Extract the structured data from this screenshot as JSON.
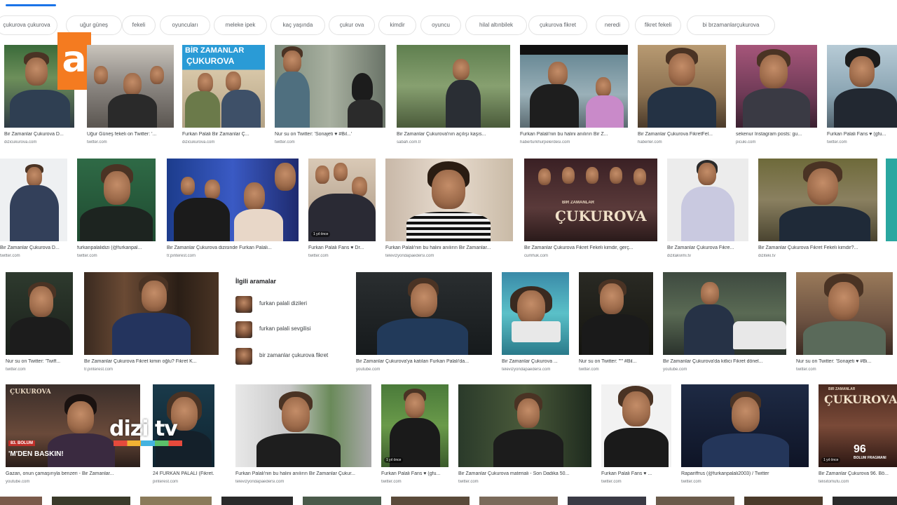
{
  "header": {
    "active_tab_indicator": true
  },
  "chips": [
    "çukurova çukurova",
    "uğur güneş",
    "fekeli",
    "oyuncuları",
    "meleke ipek",
    "kaç yaşında",
    "çukur ova",
    "kimdir",
    "oyuncu",
    "hilal altınbilek",
    "çukurova fikret",
    "neredi",
    "fikret fekeli",
    "bi brzamanlarçukurova"
  ],
  "results": {
    "row1": [
      {
        "caption": "Bir Zamanlar Çukurova D...",
        "source": "dizicukurova.com"
      },
      {
        "caption": "Uğur Güneş fekeli on Twitter: '...",
        "source": "twitter.com"
      },
      {
        "caption": "Furkan Palali Bir Zamanlar Ç...",
        "source": "dizicukurova.com"
      },
      {
        "caption": "Nur su on Twitter: 'Sonajeti ♥ #Bil...'",
        "source": "twitter.com"
      },
      {
        "caption": "Bir Zamanlar Çukurova'nın açılışı kaşıs...",
        "source": "sabah.com.tr"
      },
      {
        "caption": "Furkan Palali'nin bu halini anılırın Bir Z...",
        "source": "haberturkhurpelerdesi.com"
      },
      {
        "caption": "Bir Zamanlar Çukurova FikretFel...",
        "source": "haberler.com"
      },
      {
        "caption": "sekenur Instagram posts: gu...",
        "source": "picuki.com"
      },
      {
        "caption": "Furkan Palali Fans ♥ (gfu...",
        "source": "twitter.com"
      }
    ],
    "row2": [
      {
        "caption": "Bir Zamanlar Çukurova D...",
        "source": "twitter.com"
      },
      {
        "caption": "furkanpalalidizi (@furkanpal...",
        "source": "twitter.com"
      },
      {
        "caption": "Bir Zamanlar Çukurova dizisinde Furkan Palali...",
        "source": "tr.pinterest.com"
      },
      {
        "caption": "Furkan Palali Fans ♥ Dr...",
        "source": "twitter.com"
      },
      {
        "caption": "Furkan Palali'nin bu halini anılırın Bir Zamanlar...",
        "source": "televizyondapaedersi.com"
      },
      {
        "caption": "Bir Zamanlar Çukurova Fikret Fekeli kimdir, gerç...",
        "source": "cumhuk.com"
      },
      {
        "caption": "Bir Zamanlar Çukurova Fikre...",
        "source": "dizitakvimi.tv"
      },
      {
        "caption": "Bir Zamanlar Çukurova Fikret Fekeli kimdir?...",
        "source": "diziteki.tv"
      },
      {
        "caption": "",
        "source": ""
      }
    ],
    "row3": [
      {
        "caption": "Nur su on Twitter: 'Twiff...",
        "source": "twitter.com"
      },
      {
        "caption": "Bir Zamanlar Çukurova Fikret kimin oğlu? Fikret K...",
        "source": "tr.pinterest.com"
      },
      {
        "caption": "Bir Zamanlar Çukurova'ya katılan Furkan Palali'da...",
        "source": "youtube.com"
      },
      {
        "caption": "Bir Zamanlar Çukurova ...",
        "source": "televizyondapaedersi.com"
      },
      {
        "caption": "Nur su on Twitter: '\"\" #Bil...",
        "source": "twitter.com"
      },
      {
        "caption": "Bir Zamanlar Çukurova'da kitlici Fikret dönel...",
        "source": "youtube.com"
      },
      {
        "caption": "Nur su on Twitter: 'Sonajeti ♥ #Bi...",
        "source": "twitter.com"
      }
    ],
    "row4": [
      {
        "caption": "Gazan, onun çamaşırıyla benzeri - Bir Zamanlar...",
        "source": "youtube.com"
      },
      {
        "caption": "24 FURKAN PALALI (Fikret...",
        "source": "pinterest.com"
      },
      {
        "caption": "Furkan Palali'nin bu halini anılırın Bir Zamanlar Çukur...",
        "source": "televizyondapaedersi.com"
      },
      {
        "caption": "Furkan Palali Fans ♥ (gfu...",
        "source": "twitter.com"
      },
      {
        "caption": "Bir Zamanlar Çukurova materiali - Son Dadika 50...",
        "source": "twitter.com"
      },
      {
        "caption": "Furkan Palali Fans ♥ ...",
        "source": "twitter.com"
      },
      {
        "caption": "Rapariffrus (@furkanpalali2003) / Twitter",
        "source": "twitter.com"
      },
      {
        "caption": "Bir Zamanlar Çukurova 96. Bö...",
        "source": "telisitomufu.com"
      }
    ]
  },
  "related": {
    "title": "İlgili aramalar",
    "items": [
      "furkan palali dizileri",
      "furkan palali sevgilisi",
      "bir zamanlar çukurova fikret"
    ]
  },
  "overlays": {
    "bir_zamanlar_title": "BİR ZAMANLAR",
    "cukurova_title": "ÇUKUROVA",
    "cukurova_small": "ÇUKUROVA",
    "cukurova_banner": "ÇUKUROVA",
    "cukurova_banner_top": "BİR ZAMANLAR",
    "episode_tag": "83. BÖLÜM",
    "episode_text": "'M'DEN BASKIN!",
    "bolum_text": "BÖLÜM FRAGMANI",
    "bolum_number": "96",
    "dizi_logo": "dizi tv",
    "tv_a_logo": "a",
    "badge_1_year": "1 yıl önce",
    "badge_2_year": "1 yıl önce",
    "badge_3_year": "1 yıl önce"
  }
}
